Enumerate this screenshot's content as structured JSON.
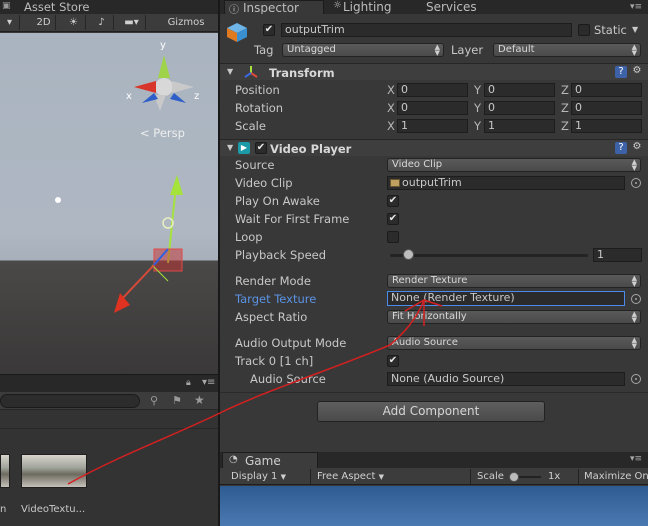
{
  "left_panel": {
    "asset_store_tab": "Asset Store",
    "toolbar": {
      "mode_2d": "2D",
      "gizmos": "Gizmos"
    },
    "scene": {
      "persp_label": "Persp",
      "axis_x": "x",
      "axis_y": "y",
      "axis_z": "z"
    },
    "project": {
      "assets": [
        {
          "label": "n"
        },
        {
          "label": "VideoTextu..."
        }
      ]
    }
  },
  "inspector": {
    "tabs": {
      "inspector": "Inspector",
      "lighting": "Lighting",
      "services": "Services"
    },
    "object_name": "outputTrim",
    "static_label": "Static",
    "tag_label": "Tag",
    "tag_value": "Untagged",
    "layer_label": "Layer",
    "layer_value": "Default",
    "transform": {
      "title": "Transform",
      "position_label": "Position",
      "rotation_label": "Rotation",
      "scale_label": "Scale",
      "position": {
        "x": "0",
        "y": "0",
        "z": "0"
      },
      "rotation": {
        "x": "0",
        "y": "0",
        "z": "0"
      },
      "scale": {
        "x": "1",
        "y": "1",
        "z": "1"
      }
    },
    "video_player": {
      "title": "Video Player",
      "source_label": "Source",
      "source_value": "Video Clip",
      "video_clip_label": "Video Clip",
      "video_clip_value": "outputTrim",
      "play_on_awake_label": "Play On Awake",
      "play_on_awake": true,
      "wait_first_frame_label": "Wait For First Frame",
      "wait_first_frame": true,
      "loop_label": "Loop",
      "loop": false,
      "playback_speed_label": "Playback Speed",
      "playback_speed_value": "1",
      "render_mode_label": "Render Mode",
      "render_mode_value": "Render Texture",
      "target_texture_label": "Target Texture",
      "target_texture_value": "None (Render Texture)",
      "aspect_ratio_label": "Aspect Ratio",
      "aspect_ratio_value": "Fit Horizontally",
      "audio_output_mode_label": "Audio Output Mode",
      "audio_output_mode_value": "Audio Source",
      "track_label": "Track 0 [1 ch]",
      "track_enabled": true,
      "audio_source_label": "Audio Source",
      "audio_source_value": "None (Audio Source)"
    },
    "add_component_label": "Add Component"
  },
  "game": {
    "tab_label": "Game",
    "display_value": "Display 1",
    "aspect_value": "Free Aspect",
    "scale_label": "Scale",
    "scale_value": "1x",
    "maximize_label": "Maximize On"
  },
  "colors": {
    "annotation": "#d42020",
    "link_label": "#5b93e6",
    "focus_border": "#4a8ae8"
  }
}
